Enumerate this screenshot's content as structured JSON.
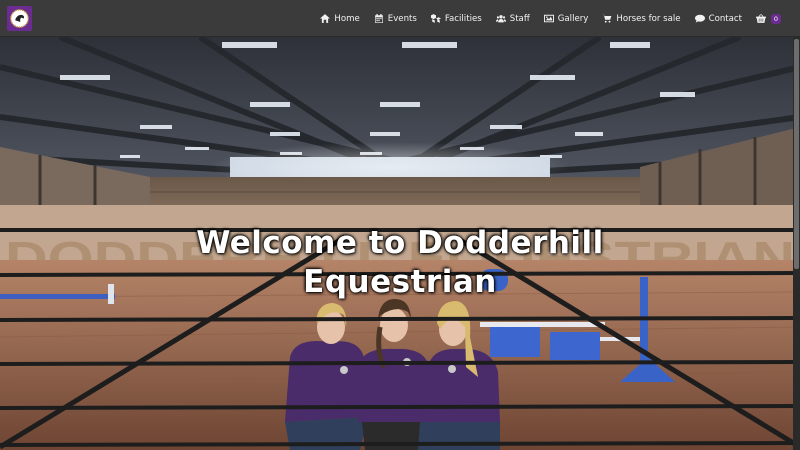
{
  "nav": {
    "logo_icon": "equestrian-logo-icon",
    "items": [
      {
        "label": "Home",
        "icon": "home-icon"
      },
      {
        "label": "Events",
        "icon": "calendar-icon"
      },
      {
        "label": "Facilities",
        "icon": "cubes-icon"
      },
      {
        "label": "Staff",
        "icon": "users-icon"
      },
      {
        "label": "Gallery",
        "icon": "image-icon"
      },
      {
        "label": "Horses for sale",
        "icon": "shopping-cart-icon"
      },
      {
        "label": "Contact",
        "icon": "comment-icon"
      }
    ],
    "cart": {
      "icon": "basket-icon",
      "count": "0"
    }
  },
  "hero": {
    "title_line1": "Welcome to Dodderhill",
    "title_line2": "Equestrian",
    "wall_sign": "DODDERHILL EQUESTRIAN"
  },
  "colors": {
    "navbar": "#3b3b3b",
    "brand_purple": "#6a2c91",
    "arena_sand": "#9a6a4f"
  }
}
